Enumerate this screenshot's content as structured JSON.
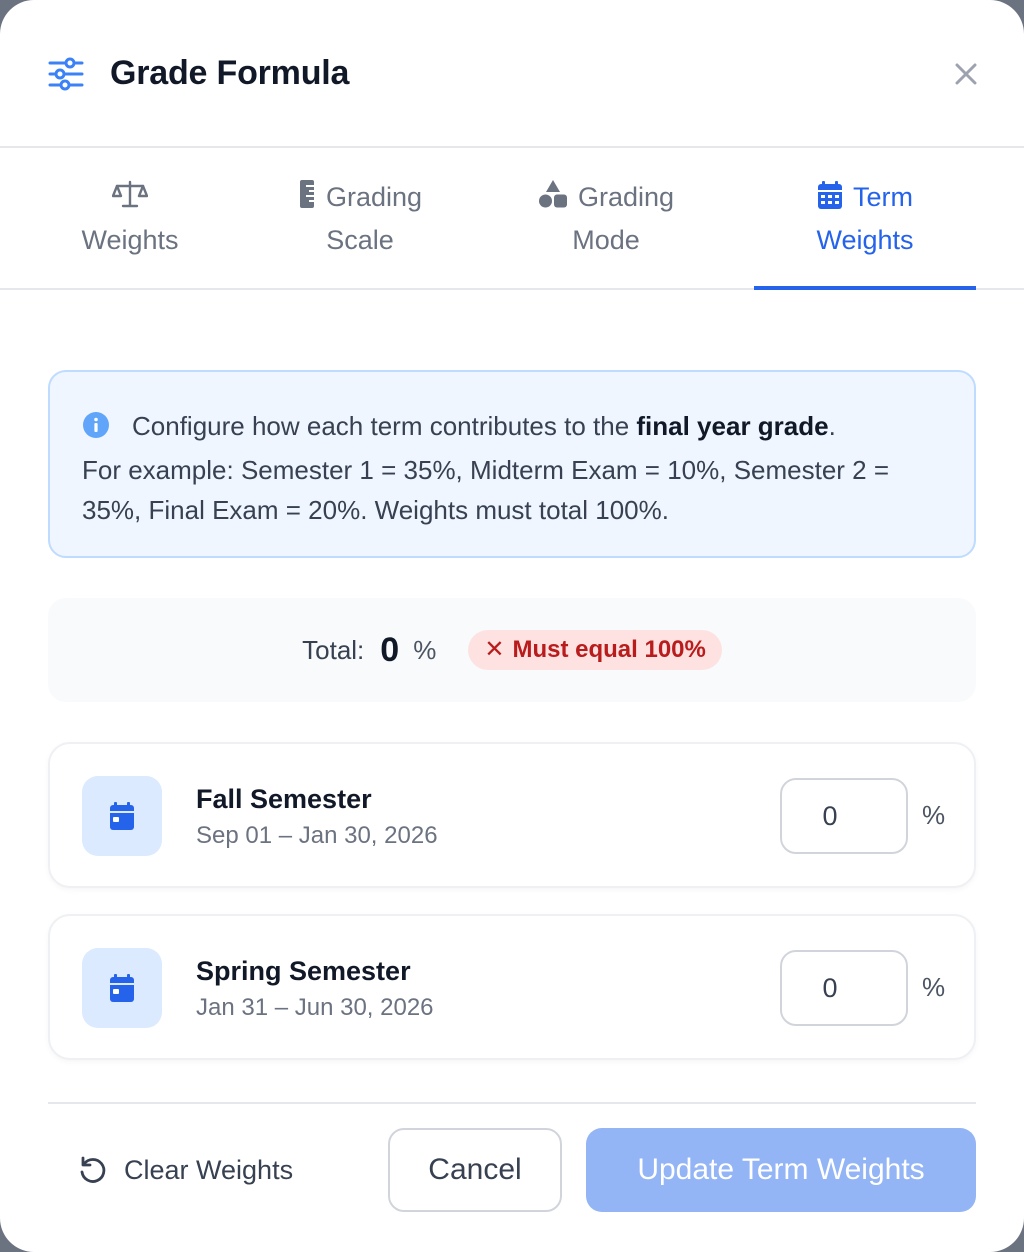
{
  "modal": {
    "title": "Grade Formula",
    "title_icon": "sliders-icon",
    "close_icon": "close-icon"
  },
  "tabs": [
    {
      "line1": "Weights",
      "line2": "",
      "icon": "scale-icon",
      "active": false
    },
    {
      "line1": "Grading",
      "line2": "Scale",
      "icon": "ruler-icon",
      "active": false
    },
    {
      "line1": "Grading",
      "line2": "Mode",
      "icon": "shapes-icon",
      "active": false
    },
    {
      "line1": "Term",
      "line2": "Weights",
      "icon": "calendar-icon",
      "active": true
    }
  ],
  "info": {
    "part1": "Configure how each term contributes to the ",
    "bold": "final year grade",
    "part2": ".",
    "example": "For example: Semester 1 = 35%, Midterm Exam = 10%, Semester 2 = 35%, Final Exam = 20%. Weights must total 100%."
  },
  "total": {
    "label": "Total:",
    "value": "0",
    "unit": "%",
    "badge": "Must equal 100%",
    "badge_icon": "x-icon"
  },
  "terms": [
    {
      "name": "Fall Semester",
      "dates": "Sep 01 – Jan 30, 2026",
      "value": "0",
      "unit": "%"
    },
    {
      "name": "Spring Semester",
      "dates": "Jan 31 – Jun 30, 2026",
      "value": "0",
      "unit": "%"
    }
  ],
  "footer": {
    "clear_label": "Clear Weights",
    "cancel_label": "Cancel",
    "update_label": "Update Term Weights"
  },
  "colors": {
    "accent": "#2563eb",
    "error": "#b91c1c",
    "update_button": "#93b4f5"
  }
}
